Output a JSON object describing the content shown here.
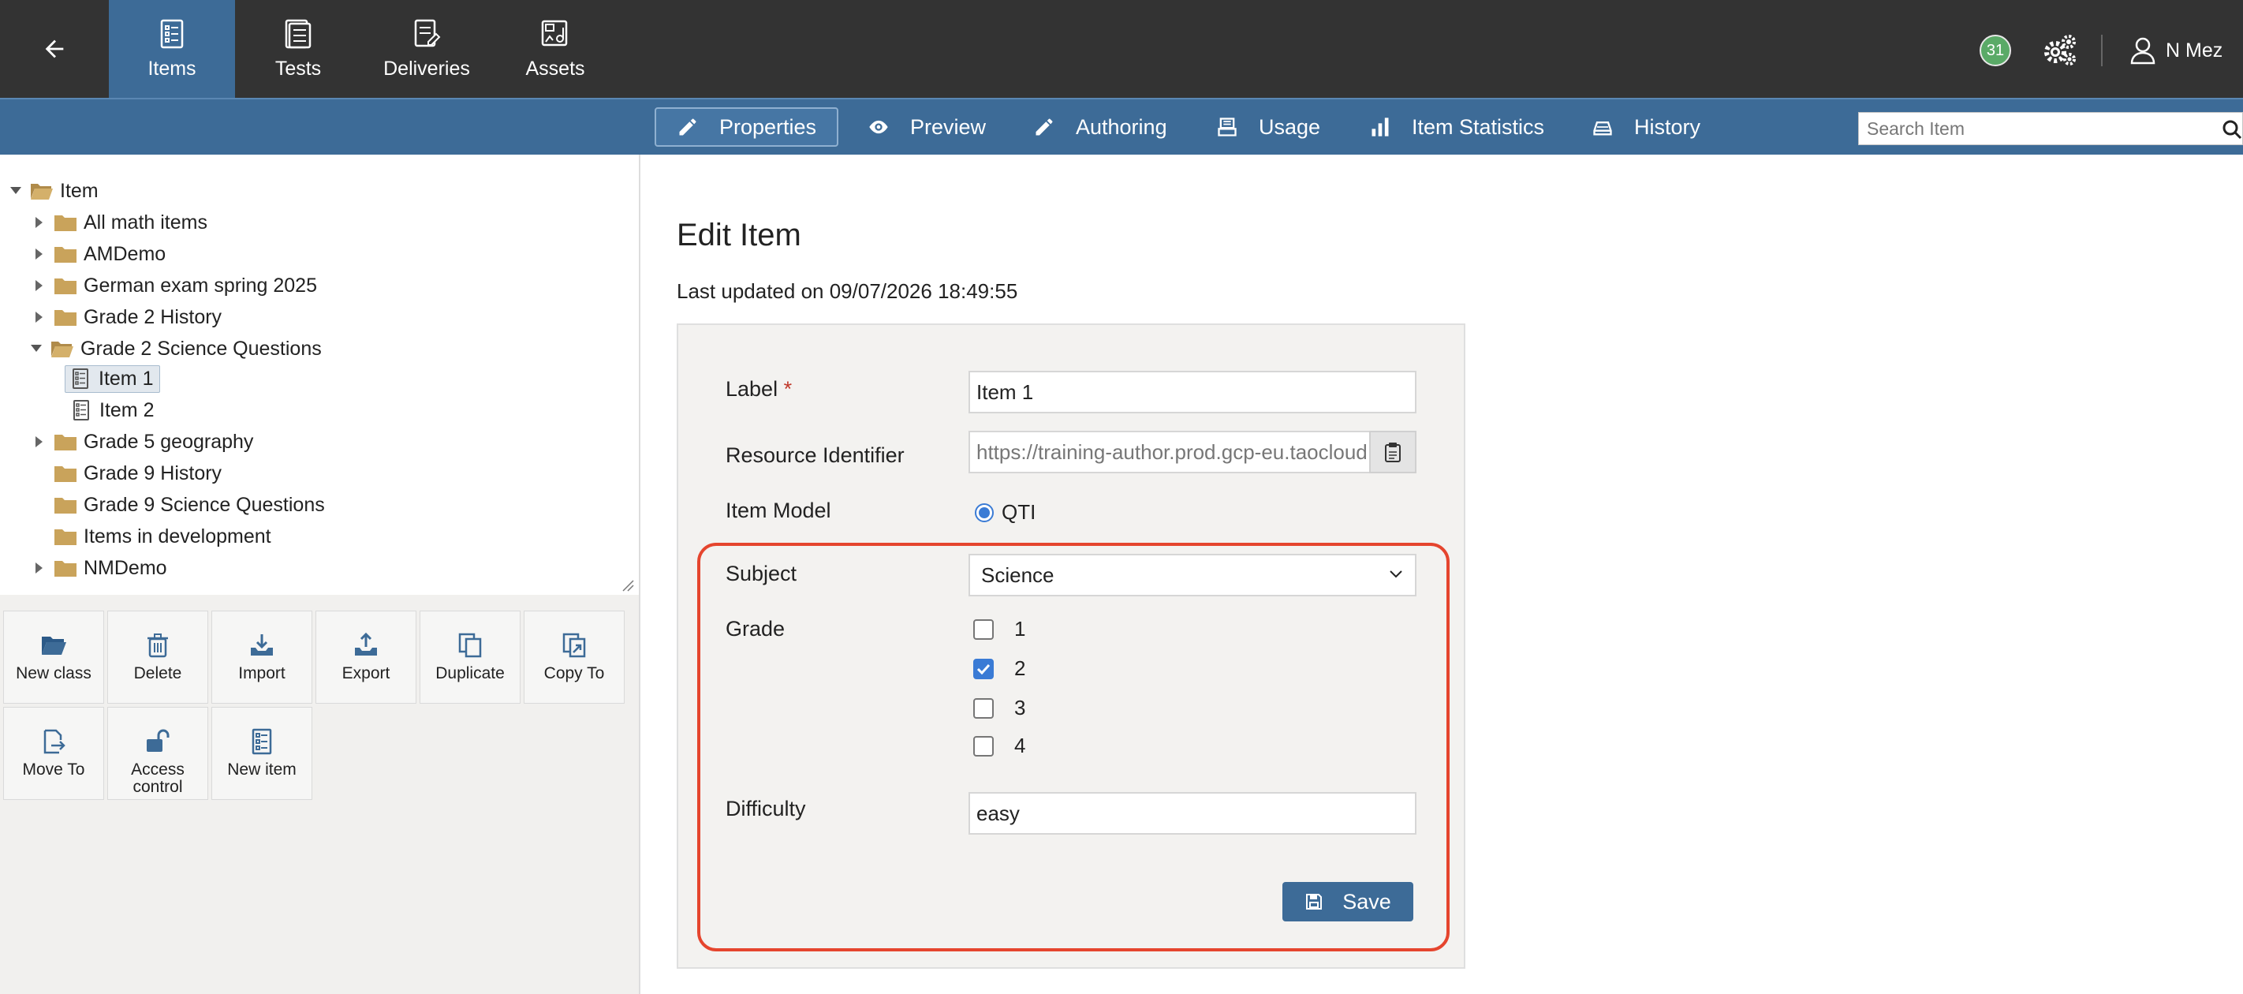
{
  "topbar": {
    "nav": [
      {
        "label": "Items",
        "icon": "items-icon",
        "active": true
      },
      {
        "label": "Tests",
        "icon": "tests-icon"
      },
      {
        "label": "Deliveries",
        "icon": "deliveries-icon"
      },
      {
        "label": "Assets",
        "icon": "assets-icon"
      }
    ],
    "notification_count": "31",
    "user_name": "N Mez"
  },
  "tabs": [
    {
      "label": "Properties",
      "icon": "pencil-icon",
      "active": true
    },
    {
      "label": "Preview",
      "icon": "eye-icon"
    },
    {
      "label": "Authoring",
      "icon": "pencil-icon"
    },
    {
      "label": "Usage",
      "icon": "usage-icon"
    },
    {
      "label": "Item Statistics",
      "icon": "bar-chart-icon"
    },
    {
      "label": "History",
      "icon": "history-icon"
    }
  ],
  "search": {
    "placeholder": "Search Item",
    "value": ""
  },
  "tree": {
    "root": "Item",
    "nodes": [
      {
        "label": "All math items"
      },
      {
        "label": "AMDemo"
      },
      {
        "label": "German exam spring 2025"
      },
      {
        "label": "Grade 2 History"
      },
      {
        "label": "Grade 2 Science Questions",
        "expanded": true,
        "children": [
          {
            "label": "Item 1",
            "selected": true
          },
          {
            "label": "Item 2"
          }
        ]
      },
      {
        "label": "Grade 5 geography"
      },
      {
        "label": "Grade 9 History"
      },
      {
        "label": "Grade 9 Science Questions"
      },
      {
        "label": "Items in development"
      },
      {
        "label": "NMDemo"
      }
    ]
  },
  "actions": [
    {
      "label": "New class",
      "icon": "folder-open-icon"
    },
    {
      "label": "Delete",
      "icon": "trash-icon"
    },
    {
      "label": "Import",
      "icon": "import-icon"
    },
    {
      "label": "Export",
      "icon": "export-icon"
    },
    {
      "label": "Duplicate",
      "icon": "duplicate-icon"
    },
    {
      "label": "Copy To",
      "icon": "copy-to-icon"
    },
    {
      "label": "Move To",
      "icon": "move-to-icon"
    },
    {
      "label": "Access control",
      "icon": "lock-icon"
    },
    {
      "label": "New item",
      "icon": "item-icon"
    }
  ],
  "form": {
    "title": "Edit Item",
    "last_updated": "Last updated on 09/07/2026 18:49:55",
    "label_label": "Label",
    "label_required": "*",
    "label_value": "Item 1",
    "resource_identifier_label": "Resource Identifier",
    "resource_identifier_value": "https://training-author.prod.gcp-eu.taocloud",
    "item_model_label": "Item Model",
    "item_model_value": "QTI",
    "subject_label": "Subject",
    "subject_value": "Science",
    "grade_label": "Grade",
    "grades": [
      {
        "label": "1",
        "checked": false
      },
      {
        "label": "2",
        "checked": true
      },
      {
        "label": "3",
        "checked": false
      },
      {
        "label": "4",
        "checked": false
      }
    ],
    "difficulty_label": "Difficulty",
    "difficulty_value": "easy",
    "save_label": "Save"
  },
  "colors": {
    "topbar": "#333333",
    "primary": "#3d6b97",
    "highlight": "#e5452e",
    "badge": "#5aaa67"
  }
}
